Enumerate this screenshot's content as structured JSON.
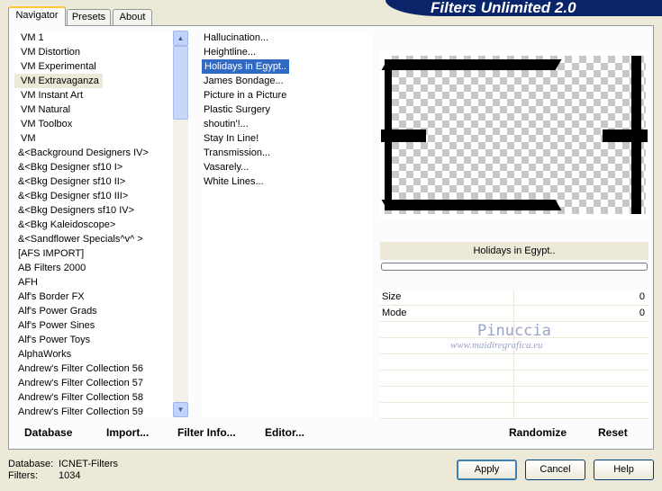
{
  "header": {
    "title": "Filters Unlimited 2.0"
  },
  "tabs": [
    {
      "label": "Navigator"
    },
    {
      "label": "Presets"
    },
    {
      "label": "About"
    }
  ],
  "categories": [
    "VM 1",
    "VM Distortion",
    "VM Experimental",
    "VM Extravaganza",
    "VM Instant Art",
    "VM Natural",
    "VM Toolbox",
    "VM",
    "&<Background Designers IV>",
    "&<Bkg Designer sf10 I>",
    "&<Bkg Designer sf10 II>",
    "&<Bkg Designer sf10 III>",
    "&<Bkg Designers sf10 IV>",
    "&<Bkg Kaleidoscope>",
    "&<Sandflower Specials^v^ >",
    "[AFS IMPORT]",
    "AB Filters 2000",
    "AFH",
    "Alf's Border FX",
    "Alf's Power Grads",
    "Alf's Power Sines",
    "Alf's Power Toys",
    "AlphaWorks",
    "Andrew's Filter Collection 56",
    "Andrew's Filter Collection 57",
    "Andrew's Filter Collection 58",
    "Andrew's Filter Collection 59"
  ],
  "selected_category": "VM Extravaganza",
  "filters": [
    "Hallucination...",
    "Heightline...",
    "Holidays in Egypt..",
    "James Bondage...",
    "Picture in a Picture",
    "Plastic Surgery",
    "shoutin'!...",
    "Stay In Line!",
    "Transmission...",
    "Vasarely...",
    "White Lines..."
  ],
  "selected_filter": "Holidays in Egypt..",
  "preview": {
    "filter_name": "Holidays in Egypt.."
  },
  "params": [
    {
      "label": "Size",
      "value": "0"
    },
    {
      "label": "Mode",
      "value": "0"
    }
  ],
  "watermark": {
    "line1": "Pinuccia",
    "line2": "www.maidiregrafica.eu"
  },
  "toolbar": {
    "database": "Database",
    "import": "Import...",
    "filter_info": "Filter Info...",
    "editor": "Editor...",
    "randomize": "Randomize",
    "reset": "Reset"
  },
  "status": {
    "database_label": "Database:",
    "database_value": "ICNET-Filters",
    "filters_label": "Filters:",
    "filters_value": "1034"
  },
  "buttons": {
    "apply": "Apply",
    "cancel": "Cancel",
    "help": "Help"
  }
}
